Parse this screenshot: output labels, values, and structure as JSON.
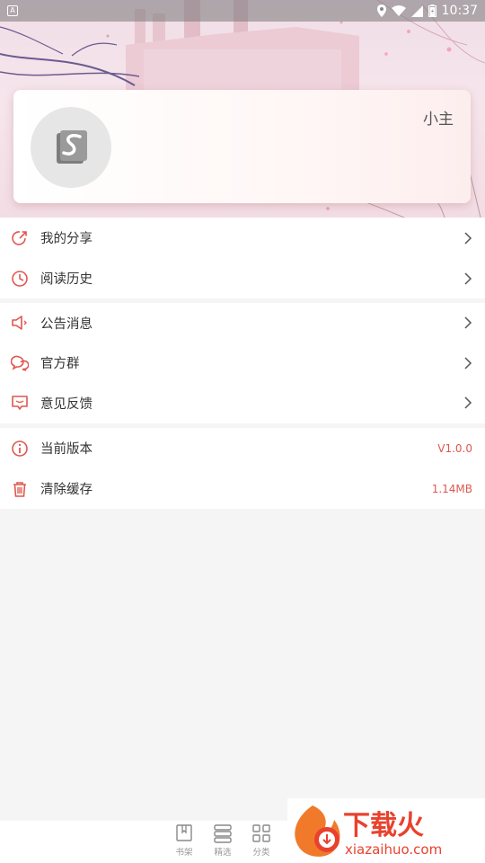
{
  "status_bar": {
    "time": "10:37",
    "icons": [
      "notification-icon",
      "location-icon",
      "wifi-icon",
      "signal-icon",
      "battery-icon"
    ]
  },
  "profile": {
    "username": "小主",
    "avatar_icon": "app-logo-icon"
  },
  "menu": {
    "group1": [
      {
        "label": "我的分享",
        "icon": "share-icon"
      },
      {
        "label": "阅读历史",
        "icon": "clock-icon"
      }
    ],
    "group2": [
      {
        "label": "公告消息",
        "icon": "speaker-icon"
      },
      {
        "label": "官方群",
        "icon": "chat-bubbles-icon"
      },
      {
        "label": "意见反馈",
        "icon": "feedback-icon"
      }
    ],
    "group3": [
      {
        "label": "当前版本",
        "icon": "info-icon",
        "value": "V1.0.0"
      },
      {
        "label": "清除缓存",
        "icon": "trash-icon",
        "value": "1.14MB"
      }
    ]
  },
  "bottom_nav": [
    {
      "label": "书架",
      "icon": "bookshelf-icon"
    },
    {
      "label": "精选",
      "icon": "featured-icon"
    },
    {
      "label": "分类",
      "icon": "category-icon"
    }
  ],
  "watermark": {
    "title": "下载火",
    "url": "xiazaihuo.com"
  },
  "colors": {
    "accent": "#e0574f",
    "text": "#333333",
    "background": "#f5f5f5"
  }
}
